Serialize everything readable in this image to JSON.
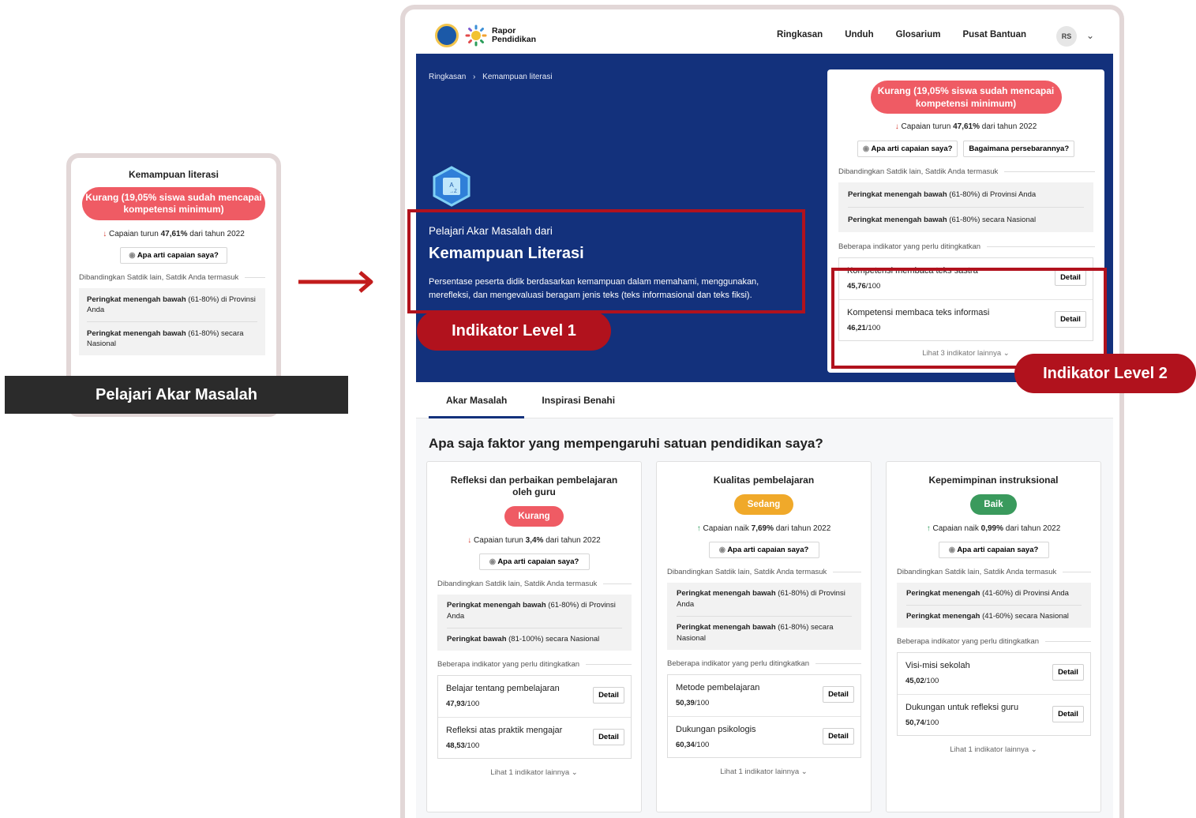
{
  "mini": {
    "title": "Kemampuan literasi",
    "badge": "Kurang (19,05% siswa sudah mencapai kompetensi minimum)",
    "trend_prefix": "Capaian turun",
    "trend_value": "47,61%",
    "trend_suffix": "dari tahun 2022",
    "button": "Apa arti capaian saya?",
    "compare_label": "Dibandingkan Satdik lain, Satdik Anda termasuk",
    "rows": [
      {
        "bold": "Peringkat menengah bawah",
        "rest": " (61-80%) di Provinsi Anda"
      },
      {
        "bold": "Peringkat menengah bawah",
        "rest": " (61-80%) secara Nasional"
      }
    ],
    "cta": "Pelajari Akar Masalah"
  },
  "nav": {
    "logo_line1": "Rapor",
    "logo_line2": "Pendidikan",
    "links": [
      "Ringkasan",
      "Unduh",
      "Glosarium",
      "Pusat Bantuan"
    ],
    "avatar": "RS"
  },
  "hero": {
    "breadcrumb_home": "Ringkasan",
    "breadcrumb_current": "Kemampuan literasi",
    "kicker": "Pelajari Akar Masalah dari",
    "title": "Kemampuan Literasi",
    "description": "Persentase peserta didik berdasarkan kemampuan dalam memahami, menggunakan, merefleksi, dan mengevaluasi beragam jenis teks (teks informasional dan teks fiksi)."
  },
  "summary": {
    "badge": "Kurang (19,05% siswa sudah mencapai kompetensi minimum)",
    "trend_prefix": "Capaian turun",
    "trend_value": "47,61%",
    "trend_suffix": "dari tahun 2022",
    "btn1": "Apa arti capaian saya?",
    "btn2": "Bagaimana persebarannya?",
    "compare_label": "Dibandingkan Satdik lain, Satdik Anda termasuk",
    "rows": [
      {
        "bold": "Peringkat menengah bawah",
        "rest": " (61-80%) di Provinsi Anda"
      },
      {
        "bold": "Peringkat menengah bawah",
        "rest": " (61-80%) secara Nasional"
      }
    ],
    "indicators_label": "Beberapa indikator yang perlu ditingkatkan",
    "indicators": [
      {
        "name": "Kompetensi membaca teks sastra",
        "score": "45,76",
        "max": "/100"
      },
      {
        "name": "Kompetensi membaca teks informasi",
        "score": "46,21",
        "max": "/100"
      }
    ],
    "detail": "Detail",
    "more": "Lihat 3 indikator lainnya"
  },
  "tabs": [
    "Akar Masalah",
    "Inspirasi Benahi"
  ],
  "question": "Apa saja faktor yang mempengaruhi satuan pendidikan saya?",
  "factors": [
    {
      "title": "Refleksi dan perbaikan pembelajaran oleh guru",
      "status": "Kurang",
      "color": "#ef5b64",
      "trend_dir": "down",
      "trend_prefix": "Capaian turun",
      "trend_value": "3,4%",
      "trend_suffix": "dari tahun 2022",
      "rows": [
        {
          "bold": "Peringkat menengah bawah",
          "rest": " (61-80%) di Provinsi Anda"
        },
        {
          "bold": "Peringkat bawah",
          "rest": " (81-100%) secara Nasional"
        }
      ],
      "indicators": [
        {
          "name": "Belajar tentang pembelajaran",
          "score": "47,93",
          "max": "/100"
        },
        {
          "name": "Refleksi atas praktik mengajar",
          "score": "48,53",
          "max": "/100"
        }
      ],
      "more": "Lihat 1 indikator lainnya"
    },
    {
      "title": "Kualitas pembelajaran",
      "status": "Sedang",
      "color": "#f0a92a",
      "trend_dir": "up",
      "trend_prefix": "Capaian naik",
      "trend_value": "7,69%",
      "trend_suffix": "dari tahun 2022",
      "rows": [
        {
          "bold": "Peringkat menengah bawah",
          "rest": " (61-80%) di Provinsi Anda"
        },
        {
          "bold": "Peringkat menengah bawah",
          "rest": " (61-80%) secara Nasional"
        }
      ],
      "indicators": [
        {
          "name": "Metode pembelajaran",
          "score": "50,39",
          "max": "/100"
        },
        {
          "name": "Dukungan psikologis",
          "score": "60,34",
          "max": "/100"
        }
      ],
      "more": "Lihat 1 indikator lainnya"
    },
    {
      "title": "Kepemimpinan instruksional",
      "status": "Baik",
      "color": "#3a9a5d",
      "trend_dir": "up",
      "trend_prefix": "Capaian naik",
      "trend_value": "0,99%",
      "trend_suffix": "dari tahun 2022",
      "rows": [
        {
          "bold": "Peringkat menengah",
          "rest": " (41-60%) di Provinsi Anda"
        },
        {
          "bold": "Peringkat menengah",
          "rest": " (41-60%) secara Nasional"
        }
      ],
      "indicators": [
        {
          "name": "Visi-misi sekolah",
          "score": "45,02",
          "max": "/100"
        },
        {
          "name": "Dukungan untuk refleksi guru",
          "score": "50,74",
          "max": "/100"
        }
      ],
      "more": "Lihat 1 indikator lainnya"
    }
  ],
  "factor_common": {
    "button": "Apa arti capaian saya?",
    "compare_label": "Dibandingkan Satdik lain, Satdik Anda termasuk",
    "indicators_label": "Beberapa indikator yang perlu ditingkatkan",
    "detail": "Detail"
  },
  "annotations": {
    "level1": "Indikator Level 1",
    "level2": "Indikator Level 2"
  },
  "colors": {
    "hero_bg": "#13317c",
    "danger": "#ef5b64",
    "annotation": "#b1121d"
  }
}
